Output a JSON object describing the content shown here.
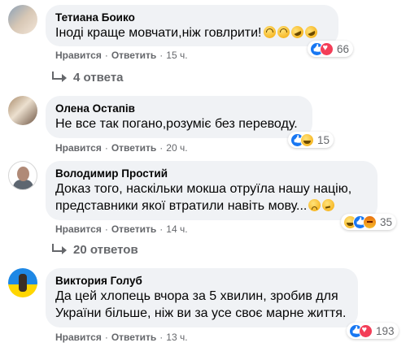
{
  "comments": [
    {
      "author": "Тетиана Боико",
      "lines": [
        "Іноді краще мовчати,ніж говлрити!"
      ],
      "inline_emoji": [
        "upside-down-face",
        "upside-down-face",
        "rofl",
        "rofl"
      ],
      "like_label": "Нравится",
      "reply_label": "Ответить",
      "time": "15 ч.",
      "reactions": [
        "like",
        "love"
      ],
      "reaction_count": "66",
      "replies_label": "4 ответа"
    },
    {
      "author": "Олена Остапів",
      "lines": [
        "Не все так погано,розуміє без переводу."
      ],
      "like_label": "Нравится",
      "reply_label": "Ответить",
      "time": "20 ч.",
      "reactions": [
        "like",
        "haha"
      ],
      "reaction_count": "15"
    },
    {
      "author": "Володимир Простий",
      "lines": [
        "Доказ того, наскільки мокша отруїла нашу націю,",
        "представники якої втратили навіть мову..."
      ],
      "inline_emoji": [
        "sad-face",
        "thinking-face"
      ],
      "like_label": "Нравится",
      "reply_label": "Ответить",
      "time": "14 ч.",
      "reactions": [
        "haha",
        "like",
        "angry"
      ],
      "reaction_count": "35",
      "replies_label": "20 ответов"
    },
    {
      "author": "Виктория Голуб",
      "lines": [
        "Да цей хлопець вчора за 5 хвилин, зробив для",
        "України більше, ніж ви за усе своє марне життя."
      ],
      "like_label": "Нравится",
      "reply_label": "Ответить",
      "time": "13 ч.",
      "reactions": [
        "like",
        "love"
      ],
      "reaction_count": "193"
    }
  ],
  "colors": {
    "bubble": "#f0f2f5",
    "secondary_text": "#65676b",
    "like_blue": "#1877f2",
    "love_red": "#f33e58"
  },
  "separator": "·"
}
